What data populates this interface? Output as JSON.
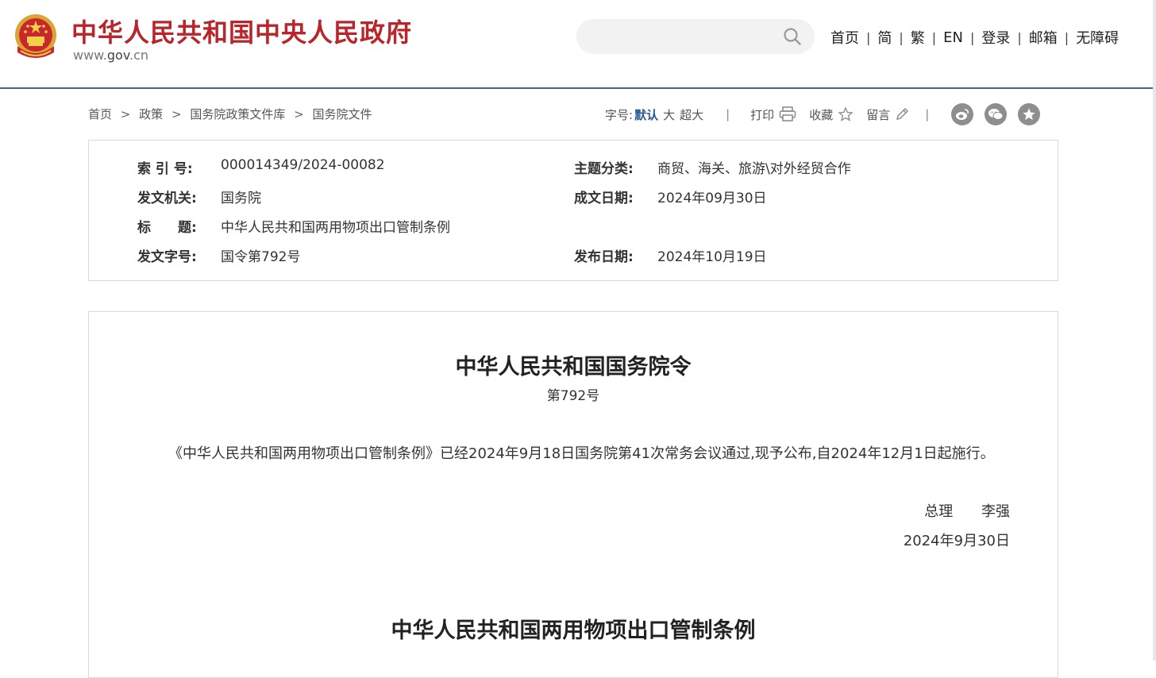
{
  "header": {
    "site_title": "中华人民共和国中央人民政府",
    "site_domain_prefix": "www.",
    "site_domain_main": "gov",
    "site_domain_suffix": ".cn",
    "search": {
      "placeholder": "",
      "value": ""
    },
    "nav": [
      "首页",
      "简",
      "繁",
      "EN",
      "登录",
      "邮箱",
      "无障碍"
    ],
    "nav_separator": "|",
    "colors": {
      "title_red": "#b8262b",
      "rule_blue": "#4a648c"
    }
  },
  "breadcrumb": {
    "items": [
      "首页",
      "政策",
      "国务院政策文件库",
      "国务院文件"
    ],
    "separator": ">"
  },
  "toolbar": {
    "font_size_label": "字号:",
    "font_default": "默认",
    "font_large": "大",
    "font_xlarge": "超大",
    "divider": "|",
    "print_label": "打印",
    "favorite_label": "收藏",
    "comment_label": "留言",
    "share_icons": [
      "weibo-icon",
      "wechat-icon",
      "favorite-star-icon"
    ]
  },
  "info": {
    "index_label": "索 引 号:",
    "index_value": "000014349/2024-00082",
    "topic_label": "主题分类:",
    "topic_value": "商贸、海关、旅游\\对外经贸合作",
    "issuer_label": "发文机关:",
    "issuer_value": "国务院",
    "written_label": "成文日期:",
    "written_value": "2024年09月30日",
    "title_label": "标　　题:",
    "title_value": "中华人民共和国两用物项出口管制条例",
    "docno_label": "发文字号:",
    "docno_value": "国令第792号",
    "published_label": "发布日期:",
    "published_value": "2024年10月19日"
  },
  "document": {
    "title": "中华人民共和国国务院令",
    "number": "第792号",
    "paragraph": "《中华人民共和国两用物项出口管制条例》已经2024年9月18日国务院第41次常务会议通过,现予公布,自2024年12月1日起施行。",
    "signer_role": "总理",
    "signer_name": "李强",
    "sign_date": "2024年9月30日",
    "regulation_title": "中华人民共和国两用物项出口管制条例"
  }
}
